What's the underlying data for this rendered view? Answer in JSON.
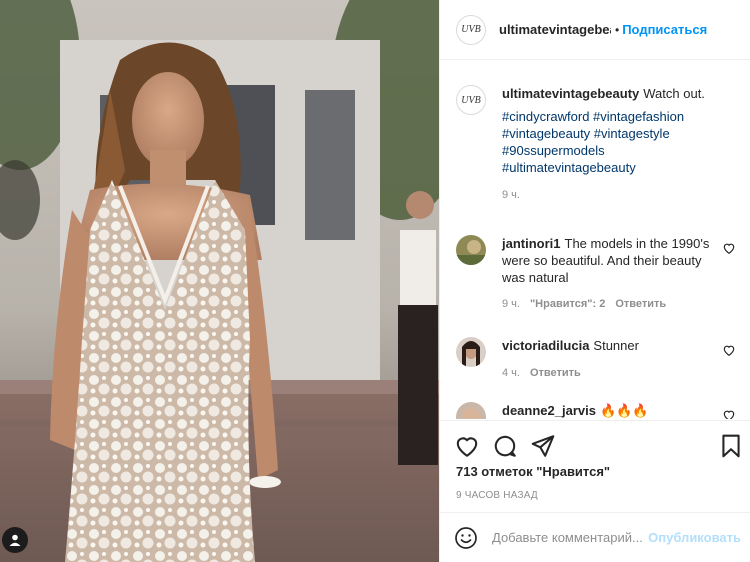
{
  "photo": {
    "alt_icon": "user-tag-icon"
  },
  "header": {
    "avatar_text": "UVB",
    "username": "ultimatevintagebeauty",
    "dot": "•",
    "follow_label": "Подписаться"
  },
  "caption": {
    "avatar_text": "UVB",
    "username": "ultimatevintagebeauty",
    "text": "Watch out.",
    "hashtags": [
      "#cindycrawford #vintagefashion",
      "#vintagebeauty #vintagestyle",
      "#90ssupermodels",
      "#ultimatevintagebeauty"
    ],
    "time": "9 ч."
  },
  "comments": [
    {
      "username": "jantinori1",
      "text": "The models in the 1990's were so beautiful. And their beauty was natural",
      "time": "9 ч.",
      "likes": "\"Нравится\": 2",
      "reply": "Ответить"
    },
    {
      "username": "victoriadilucia",
      "text": "Stunner",
      "time": "4 ч.",
      "reply": "Ответить"
    },
    {
      "username": "deanne2_jarvis",
      "text": "🔥🔥🔥"
    }
  ],
  "actions": {
    "likes": "713 отметок \"Нравится\"",
    "posted": "9 ЧАСОВ НАЗАД"
  },
  "add_comment": {
    "placeholder": "Добавьте комментарий...",
    "post_label": "Опубликовать"
  },
  "colors": {
    "link": "#0095f6",
    "hashtag": "#00376b",
    "muted": "#8e8e8e"
  }
}
